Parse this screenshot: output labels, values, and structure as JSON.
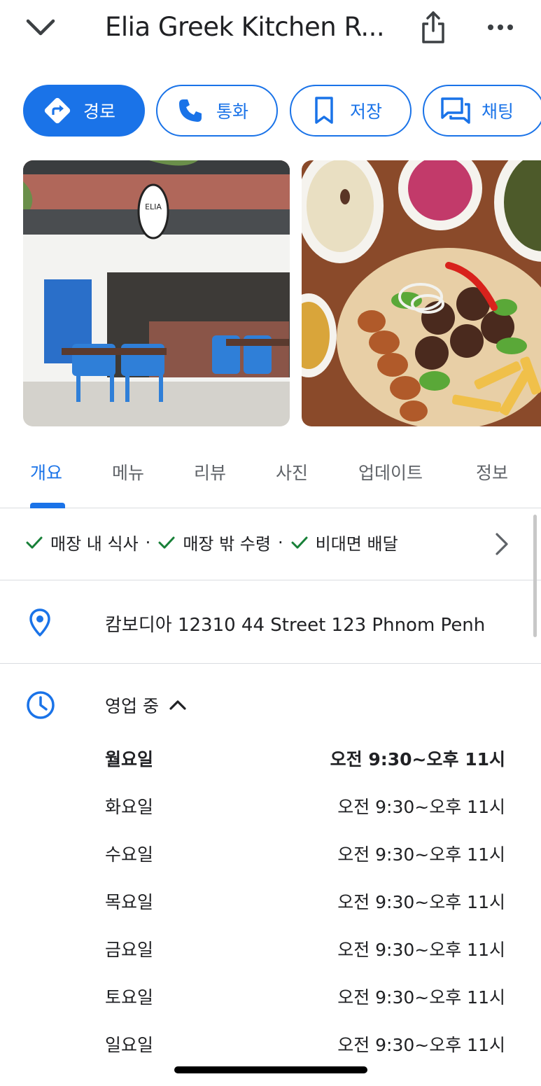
{
  "header": {
    "title": "Elia Greek Kitchen R...",
    "back_icon": "chevron-down-icon",
    "share_icon": "share-icon",
    "more_icon": "more-horizontal-icon"
  },
  "actions": [
    {
      "label": "경로",
      "icon": "directions-icon"
    },
    {
      "label": "통화",
      "icon": "phone-icon"
    },
    {
      "label": "저장",
      "icon": "bookmark-icon"
    },
    {
      "label": "채팅",
      "icon": "chat-icon"
    }
  ],
  "tabs": [
    {
      "label": "개요",
      "active": true
    },
    {
      "label": "메뉴"
    },
    {
      "label": "리뷰"
    },
    {
      "label": "사진"
    },
    {
      "label": "업데이트"
    },
    {
      "label": "정보"
    }
  ],
  "services": {
    "items": [
      "매장 내 식사",
      "매장 밖 수령",
      "비대면 배달"
    ],
    "separator": "·"
  },
  "address": "캄보디아 12310 44 Street 123 Phnom Penh",
  "hours": {
    "status": "영업 중",
    "days": [
      {
        "day": "월요일",
        "time": "오전 9:30~오후 11시",
        "today": true
      },
      {
        "day": "화요일",
        "time": "오전 9:30~오후 11시"
      },
      {
        "day": "수요일",
        "time": "오전 9:30~오후 11시"
      },
      {
        "day": "목요일",
        "time": "오전 9:30~오후 11시"
      },
      {
        "day": "금요일",
        "time": "오전 9:30~오후 11시"
      },
      {
        "day": "토요일",
        "time": "오전 9:30~오후 11시"
      },
      {
        "day": "일요일",
        "time": "오전 9:30~오후 11시"
      }
    ]
  },
  "photos": {
    "storefront_sign": "ELIA"
  },
  "colors": {
    "accent": "#1a73e8",
    "check": "#188038",
    "divider": "#dadce0"
  }
}
